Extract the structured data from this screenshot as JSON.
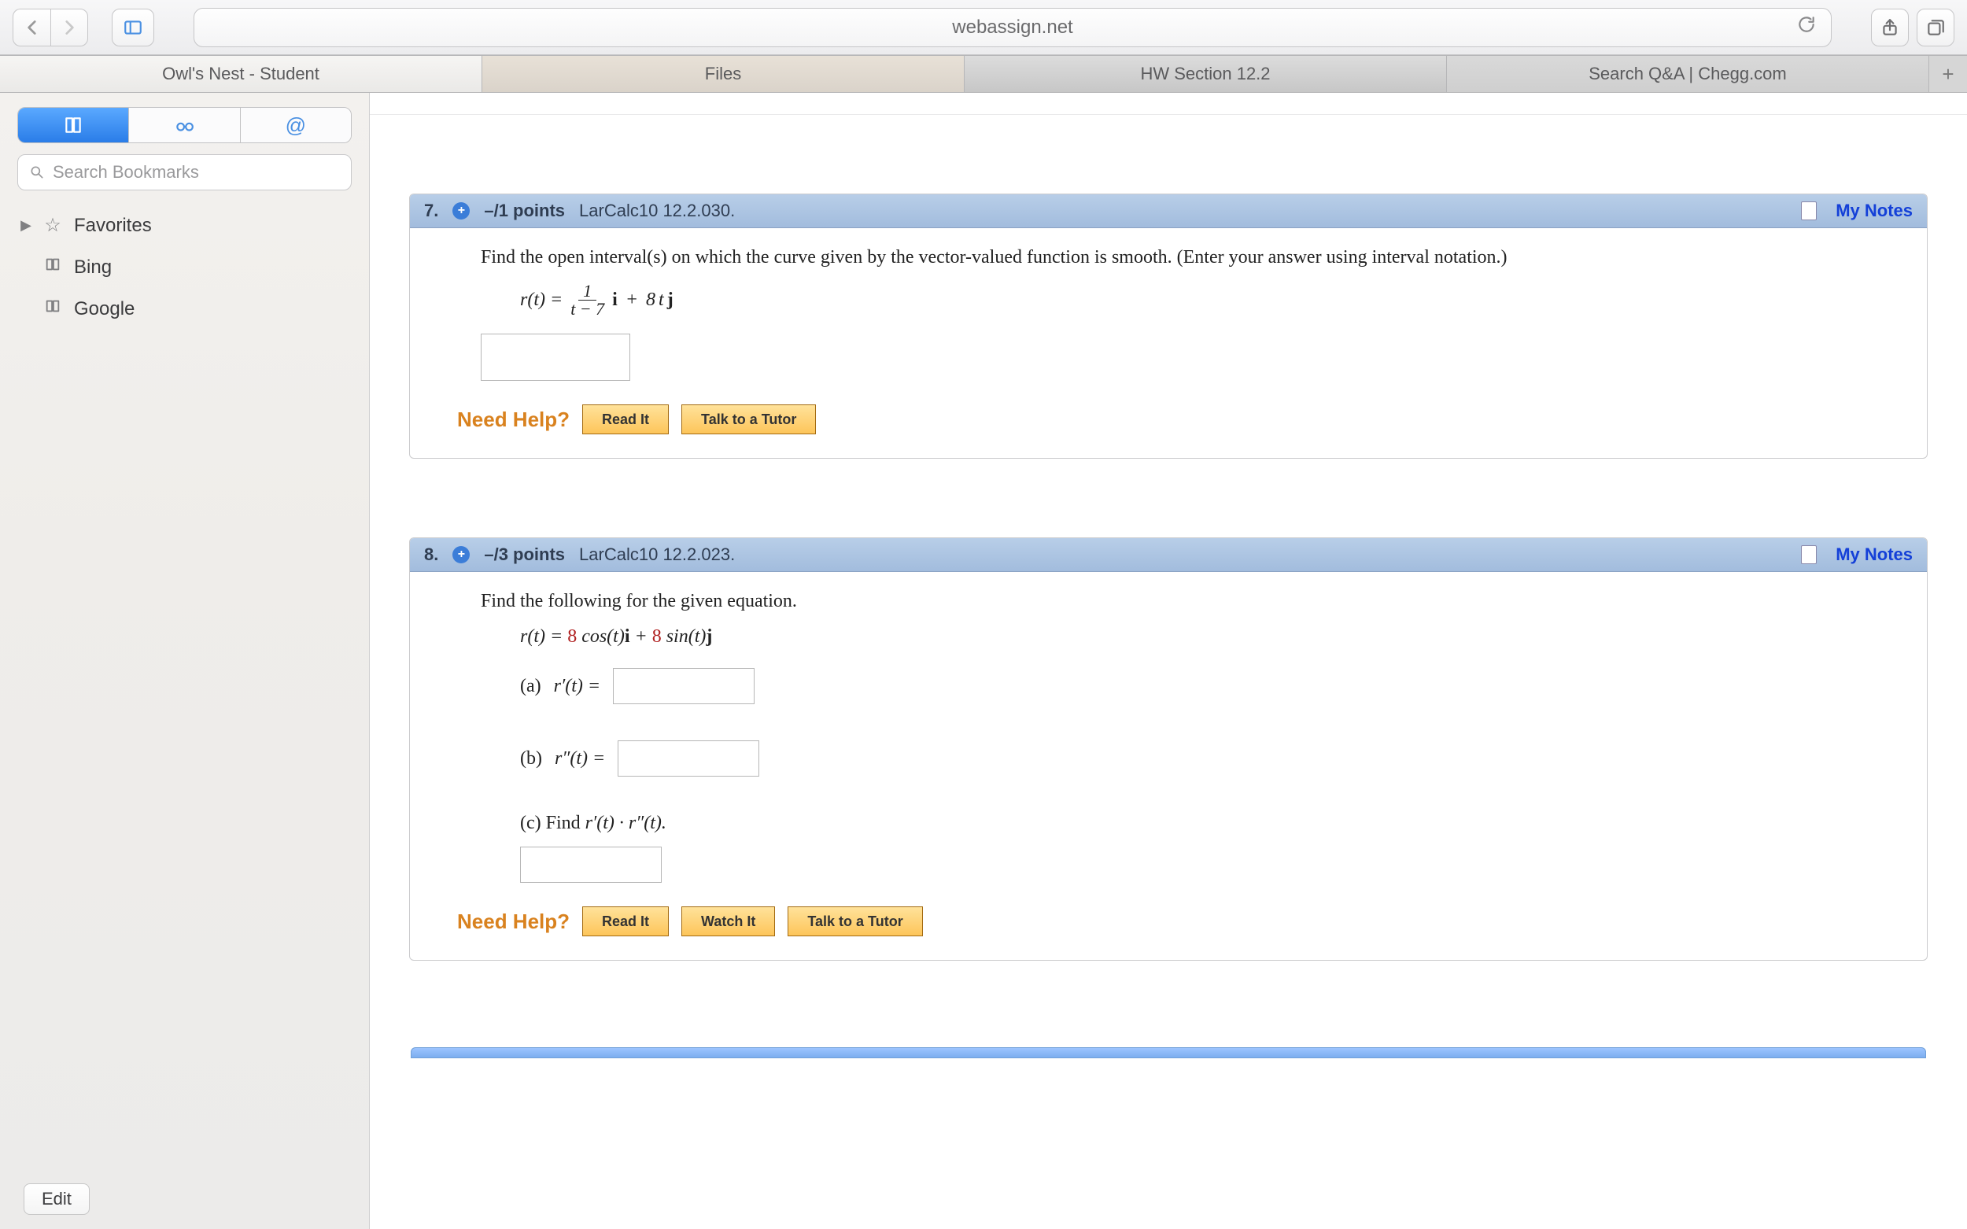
{
  "toolbar": {
    "url": "webassign.net"
  },
  "tabs": [
    "Owl's Nest - Student",
    "Files",
    "HW Section 12.2",
    "Search Q&A | Chegg.com"
  ],
  "sidebar": {
    "search_placeholder": "Search Bookmarks",
    "items": [
      {
        "icon": "star",
        "label": "Favorites",
        "expandable": true
      },
      {
        "icon": "book",
        "label": "Bing",
        "expandable": false
      },
      {
        "icon": "book",
        "label": "Google",
        "expandable": false
      }
    ],
    "edit_label": "Edit"
  },
  "questions": [
    {
      "num": "7.",
      "points": "–/1 points",
      "source": "LarCalc10 12.2.030.",
      "notes": "My Notes",
      "prompt": "Find the open interval(s) on which the curve given by the vector-valued function is smooth. (Enter your answer using interval notation.)",
      "eq_lhs": "r(t) = ",
      "frac_top": "1",
      "frac_bot": "t − 7",
      "eq_mid": "i + 8t",
      "eq_j": "j",
      "coef8": "8",
      "need_help": "Need Help?",
      "buttons": [
        "Read It",
        "Talk to a Tutor"
      ]
    },
    {
      "num": "8.",
      "points": "–/3 points",
      "source": "LarCalc10 12.2.023.",
      "notes": "My Notes",
      "prompt": "Find the following for the given equation.",
      "eq_full_pre": "r(t) = ",
      "c1": "8",
      "mid1": " cos(t)",
      "ibold": "i",
      "plus": " + ",
      "c2": "8",
      "mid2": " sin(t)",
      "jbold": "j",
      "parts": {
        "a_label": "(a)",
        "a_math": "r′(t) = ",
        "b_label": "(b)",
        "b_math": "r″(t) = ",
        "c_text_pre": "(c) Find ",
        "c_math": "r′(t) · r″(t)."
      },
      "need_help": "Need Help?",
      "buttons": [
        "Read It",
        "Watch It",
        "Talk to a Tutor"
      ]
    }
  ]
}
